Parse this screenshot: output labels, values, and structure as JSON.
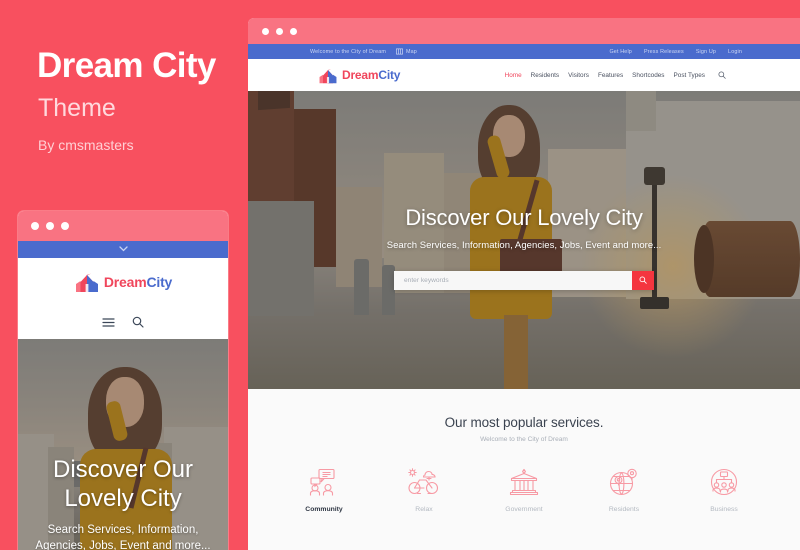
{
  "promo": {
    "title": "Dream City",
    "subtitle": "Theme",
    "byline": "By cmsmasters"
  },
  "colors": {
    "background": "#F8505F",
    "browser_chrome": "#F97382",
    "topbar_blue": "#4A6BCD",
    "accent_red": "#F0465C",
    "search_button": "#F4353F",
    "services_bg": "#FAFAFA"
  },
  "desktop": {
    "topbar": {
      "welcome": "Welcome to the City of Dream",
      "map_label": "Map",
      "links": [
        "Get Help",
        "Press Releases",
        "Sign Up",
        "Login"
      ]
    },
    "logo": {
      "first": "Dream",
      "second": "City",
      "icon": "city-building-icon"
    },
    "menu": [
      {
        "label": "Home",
        "active": true
      },
      {
        "label": "Residents",
        "active": false
      },
      {
        "label": "Visitors",
        "active": false
      },
      {
        "label": "Features",
        "active": false
      },
      {
        "label": "Shortcodes",
        "active": false
      },
      {
        "label": "Post Types",
        "active": false
      }
    ],
    "search_icon": "search-icon",
    "hero": {
      "heading": "Discover Our Lovely City",
      "subheading": "Search Services, Information, Agencies, Jobs, Event and more...",
      "input_placeholder": "enter keywords",
      "input_value": "",
      "button_icon": "search-icon"
    },
    "services": {
      "title": "Our most popular services.",
      "subtitle": "Welcome to the City of Dream",
      "items": [
        {
          "label": "Community",
          "icon": "community-icon",
          "active": true
        },
        {
          "label": "Relax",
          "icon": "bicycle-icon",
          "active": false
        },
        {
          "label": "Government",
          "icon": "bank-building-icon",
          "active": false
        },
        {
          "label": "Residents",
          "icon": "globe-pin-icon",
          "active": false
        },
        {
          "label": "Business",
          "icon": "org-chart-icon",
          "active": false
        }
      ]
    }
  },
  "mobile": {
    "chevron_icon": "chevron-down-icon",
    "logo": {
      "first": "Dream",
      "second": "City",
      "icon": "city-building-icon"
    },
    "menu_icon": "hamburger-menu-icon",
    "search_icon": "search-icon",
    "hero": {
      "heading_line1": "Discover Our",
      "heading_line2": "Lovely City",
      "subheading": "Search Services, Information, Agencies, Jobs, Event and more..."
    }
  }
}
